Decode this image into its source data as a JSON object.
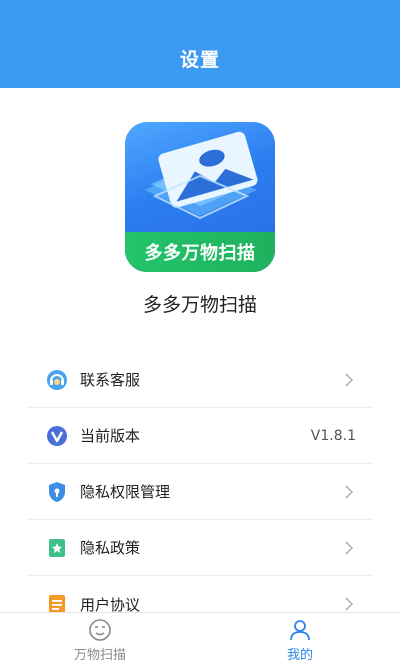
{
  "header": {
    "title": "设置"
  },
  "app": {
    "logo_text": "多多万物扫描",
    "name": "多多万物扫描"
  },
  "menu": {
    "items": [
      {
        "label": "联系客服",
        "icon": "customer-service-icon",
        "value": ""
      },
      {
        "label": "当前版本",
        "icon": "version-icon",
        "value": "V1.8.1"
      },
      {
        "label": "隐私权限管理",
        "icon": "privacy-shield-icon",
        "value": ""
      },
      {
        "label": "隐私政策",
        "icon": "privacy-policy-icon",
        "value": ""
      },
      {
        "label": "用户协议",
        "icon": "user-agreement-icon",
        "value": ""
      }
    ]
  },
  "tabbar": {
    "tabs": [
      {
        "label": "万物扫描",
        "icon": "scan-face-icon",
        "active": false
      },
      {
        "label": "我的",
        "icon": "user-icon",
        "active": true
      }
    ]
  },
  "colors": {
    "header_bg": "#3d9af3",
    "accent": "#2b86e8",
    "logo_green": "#23c46a"
  }
}
